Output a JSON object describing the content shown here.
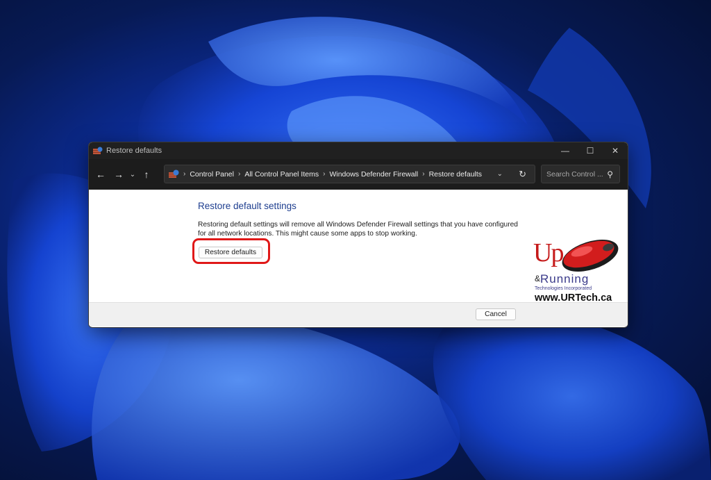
{
  "window": {
    "title": "Restore defaults",
    "controls": {
      "minimize": "—",
      "maximize": "☐",
      "close": "✕"
    }
  },
  "address": {
    "crumbs": [
      "Control Panel",
      "All Control Panel Items",
      "Windows Defender Firewall",
      "Restore defaults"
    ],
    "search_placeholder": "Search Control ..."
  },
  "content": {
    "heading": "Restore default settings",
    "description": "Restoring default settings will remove all Windows Defender Firewall settings that you have configured for all network locations. This might cause some apps to stop working.",
    "restore_button": "Restore defaults"
  },
  "footer": {
    "cancel_button": "Cancel"
  },
  "watermark": {
    "up": "Up",
    "amp": "&",
    "running": "Running",
    "subtitle": "Technologies Incorporated",
    "url": "www.URTech.ca"
  },
  "colors": {
    "highlight": "#e01818",
    "heading": "#1e3e8f",
    "titlebar": "#202020"
  }
}
